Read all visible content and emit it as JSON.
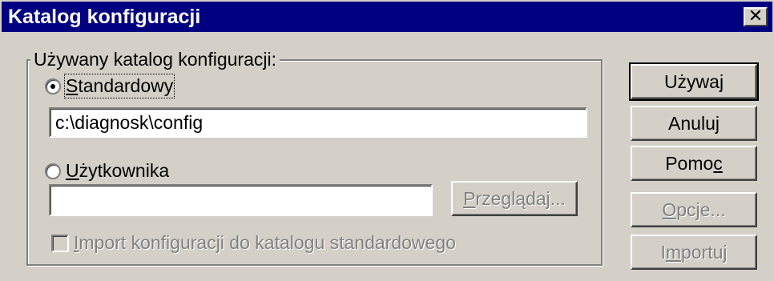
{
  "window": {
    "title": "Katalog konfiguracji",
    "close_glyph": "✕"
  },
  "group": {
    "legend": "Używany katalog konfiguracji:"
  },
  "options": {
    "standard": {
      "prefix": "",
      "accel": "S",
      "rest": "tandardowy",
      "checked": true
    },
    "user": {
      "prefix": "",
      "accel": "U",
      "rest": "żytkownika",
      "checked": false
    }
  },
  "fields": {
    "standard_path": "c:\\diagnosk\\config",
    "user_path": ""
  },
  "buttons": {
    "browse": {
      "accel": "P",
      "rest": "rzeglądaj...",
      "enabled": false
    },
    "use": {
      "label": "Używaj",
      "default": true
    },
    "cancel": {
      "label": "Anuluj"
    },
    "help": {
      "before": "Pomo",
      "accel": "c",
      "after": ""
    },
    "options": {
      "accel": "O",
      "rest": "pcje...",
      "enabled": false
    },
    "import": {
      "before": "I",
      "accel": "m",
      "after": "portuj",
      "enabled": false
    }
  },
  "import_checkbox": {
    "accel": "I",
    "rest": "mport konfiguracji do katalogu standardowego",
    "checked": false,
    "enabled": false
  },
  "colors": {
    "titlebar": "#000080",
    "face": "#d4d0c8",
    "disabled_text": "#808080"
  }
}
